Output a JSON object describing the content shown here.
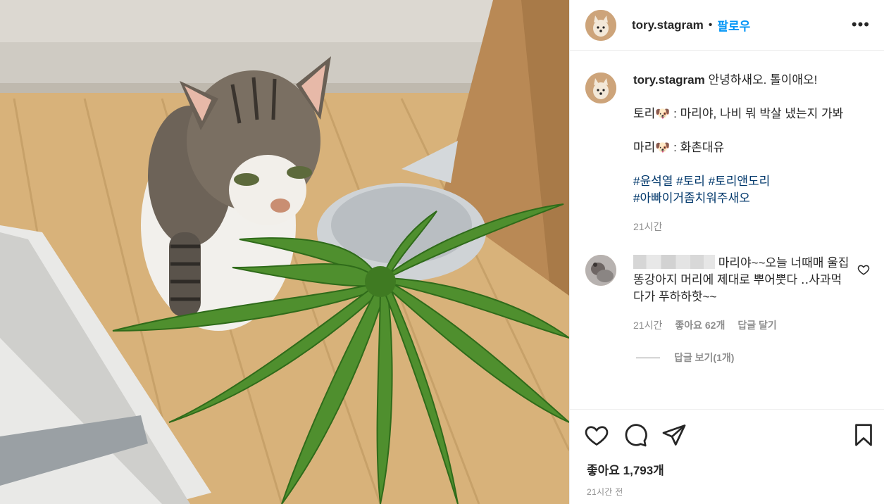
{
  "post": {
    "photo_alt": "",
    "author": "tory.stagram",
    "dot": "•",
    "follow_label": "팔로우",
    "more_label": "•••"
  },
  "caption": {
    "username": "tory.stagram",
    "line1": "안녕하새오. 톨이애오!",
    "line2": "토리🐶 : 마리야, 나비 뭐 박살 냈는지 가봐",
    "line3": "마리🐶 : 화촌대유",
    "hashtags_line1": [
      "#윤석열",
      "#토리",
      "#토리앤도리"
    ],
    "hashtags_line2": [
      "#아빠이거좀치워주새오"
    ],
    "time": "21시간"
  },
  "comment": {
    "text": "마리야~~오늘 너때매 울집 똥강아지 머리에 제대로 뿌어뿟다 ‥사과먹다가 푸하하핫~~",
    "time": "21시간",
    "likes": "좋아요 62개",
    "reply": "답글 달기",
    "view_replies": "답글 보기(1개)"
  },
  "actions": {
    "icons": [
      "heart-icon",
      "comment-icon",
      "share-icon",
      "bookmark-icon"
    ]
  },
  "likes_label": "좋아요 1,793개",
  "posted_label": "21시간 전",
  "colors": {
    "link": "#0095f6",
    "hashtag": "#00376b",
    "muted": "#8e8e8e",
    "text": "#262626"
  }
}
